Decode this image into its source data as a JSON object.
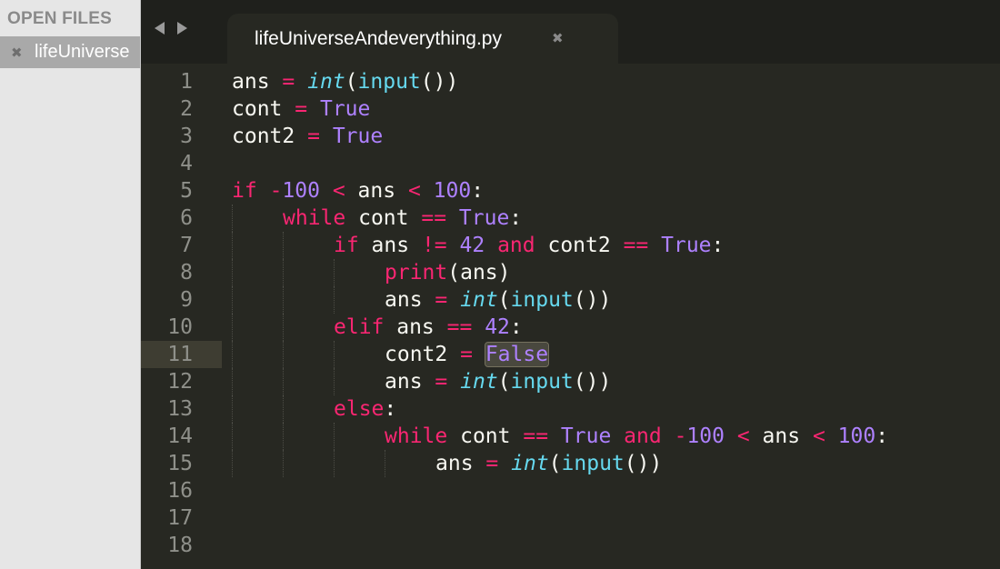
{
  "sidebar": {
    "header": "OPEN FILES",
    "files": [
      {
        "name": "lifeUniverseAndeverything.py",
        "visible_label": "lifeUniverse",
        "close_icon": "close-icon"
      }
    ]
  },
  "tabs": [
    {
      "title": "lifeUniverseAndeverything.py",
      "close_icon": "close-icon",
      "active": true
    }
  ],
  "nav": {
    "back_icon": "arrow-left-icon",
    "forward_icon": "arrow-right-icon"
  },
  "colors": {
    "background": "#272822",
    "keyword": "#f92672",
    "number": "#ae81ff",
    "builtin": "#66d9ef",
    "text": "#f8f8f2",
    "line_number": "#8f908a"
  },
  "editor": {
    "current_line": 11,
    "lines": [
      {
        "number": "1",
        "indent": 0,
        "tokens": [
          [
            "ans",
            "text"
          ],
          [
            " ",
            "text"
          ],
          [
            "=",
            "op"
          ],
          [
            " ",
            "text"
          ],
          [
            "int",
            "type"
          ],
          [
            "(",
            "text"
          ],
          [
            "input",
            "fn"
          ],
          [
            "())",
            "text"
          ]
        ]
      },
      {
        "number": "2",
        "indent": 0,
        "tokens": [
          [
            "cont",
            "text"
          ],
          [
            " ",
            "text"
          ],
          [
            "=",
            "op"
          ],
          [
            " ",
            "text"
          ],
          [
            "True",
            "const"
          ]
        ]
      },
      {
        "number": "3",
        "indent": 0,
        "tokens": [
          [
            "cont2",
            "text"
          ],
          [
            " ",
            "text"
          ],
          [
            "=",
            "op"
          ],
          [
            " ",
            "text"
          ],
          [
            "True",
            "const"
          ]
        ]
      },
      {
        "number": "4",
        "indent": 0,
        "tokens": []
      },
      {
        "number": "5",
        "indent": 0,
        "tokens": [
          [
            "if",
            "kw"
          ],
          [
            " ",
            "text"
          ],
          [
            "-",
            "op"
          ],
          [
            "100",
            "num"
          ],
          [
            " ",
            "text"
          ],
          [
            "<",
            "op"
          ],
          [
            " ans ",
            "text"
          ],
          [
            "<",
            "op"
          ],
          [
            " ",
            "text"
          ],
          [
            "100",
            "num"
          ],
          [
            ":",
            "text"
          ]
        ]
      },
      {
        "number": "6",
        "indent": 1,
        "tokens": [
          [
            "while",
            "kw"
          ],
          [
            " cont ",
            "text"
          ],
          [
            "==",
            "op"
          ],
          [
            " ",
            "text"
          ],
          [
            "True",
            "const"
          ],
          [
            ":",
            "text"
          ]
        ]
      },
      {
        "number": "7",
        "indent": 2,
        "tokens": [
          [
            "if",
            "kw"
          ],
          [
            " ans ",
            "text"
          ],
          [
            "!=",
            "op"
          ],
          [
            " ",
            "text"
          ],
          [
            "42",
            "num"
          ],
          [
            " ",
            "text"
          ],
          [
            "and",
            "kw"
          ],
          [
            " cont2 ",
            "text"
          ],
          [
            "==",
            "op"
          ],
          [
            " ",
            "text"
          ],
          [
            "True",
            "const"
          ],
          [
            ":",
            "text"
          ]
        ]
      },
      {
        "number": "8",
        "indent": 3,
        "tokens": [
          [
            "print",
            "fn2"
          ],
          [
            "(ans)",
            "text"
          ]
        ]
      },
      {
        "number": "9",
        "indent": 3,
        "tokens": [
          [
            "ans",
            "text"
          ],
          [
            " ",
            "text"
          ],
          [
            "=",
            "op"
          ],
          [
            " ",
            "text"
          ],
          [
            "int",
            "type"
          ],
          [
            "(",
            "text"
          ],
          [
            "input",
            "fn"
          ],
          [
            "())",
            "text"
          ]
        ]
      },
      {
        "number": "10",
        "indent": 2,
        "tokens": [
          [
            "elif",
            "kw"
          ],
          [
            " ans ",
            "text"
          ],
          [
            "==",
            "op"
          ],
          [
            " ",
            "text"
          ],
          [
            "42",
            "num"
          ],
          [
            ":",
            "text"
          ]
        ]
      },
      {
        "number": "11",
        "indent": 3,
        "tokens": [
          [
            "cont2",
            "text"
          ],
          [
            " ",
            "text"
          ],
          [
            "=",
            "op"
          ],
          [
            " ",
            "text"
          ],
          [
            "False",
            "hl"
          ]
        ]
      },
      {
        "number": "12",
        "indent": 3,
        "tokens": [
          [
            "ans",
            "text"
          ],
          [
            " ",
            "text"
          ],
          [
            "=",
            "op"
          ],
          [
            " ",
            "text"
          ],
          [
            "int",
            "type"
          ],
          [
            "(",
            "text"
          ],
          [
            "input",
            "fn"
          ],
          [
            "())",
            "text"
          ]
        ]
      },
      {
        "number": "13",
        "indent": 2,
        "tokens": [
          [
            "else",
            "kw"
          ],
          [
            ":",
            "text"
          ]
        ]
      },
      {
        "number": "14",
        "indent": 3,
        "tokens": [
          [
            "while",
            "kw"
          ],
          [
            " cont ",
            "text"
          ],
          [
            "==",
            "op"
          ],
          [
            " ",
            "text"
          ],
          [
            "True",
            "const"
          ],
          [
            " ",
            "text"
          ],
          [
            "and",
            "kw"
          ],
          [
            " ",
            "text"
          ],
          [
            "-",
            "op"
          ],
          [
            "100",
            "num"
          ],
          [
            " ",
            "text"
          ],
          [
            "<",
            "op"
          ],
          [
            " ans ",
            "text"
          ],
          [
            "<",
            "op"
          ],
          [
            " ",
            "text"
          ],
          [
            "100",
            "num"
          ],
          [
            ":",
            "text"
          ]
        ]
      },
      {
        "number": "15",
        "indent": 4,
        "tokens": [
          [
            "ans",
            "text"
          ],
          [
            " ",
            "text"
          ],
          [
            "=",
            "op"
          ],
          [
            " ",
            "text"
          ],
          [
            "int",
            "type"
          ],
          [
            "(",
            "text"
          ],
          [
            "input",
            "fn"
          ],
          [
            "())",
            "text"
          ]
        ]
      },
      {
        "number": "16",
        "indent": 0,
        "tokens": []
      },
      {
        "number": "17",
        "indent": 0,
        "tokens": []
      },
      {
        "number": "18",
        "indent": 0,
        "tokens": []
      }
    ]
  }
}
